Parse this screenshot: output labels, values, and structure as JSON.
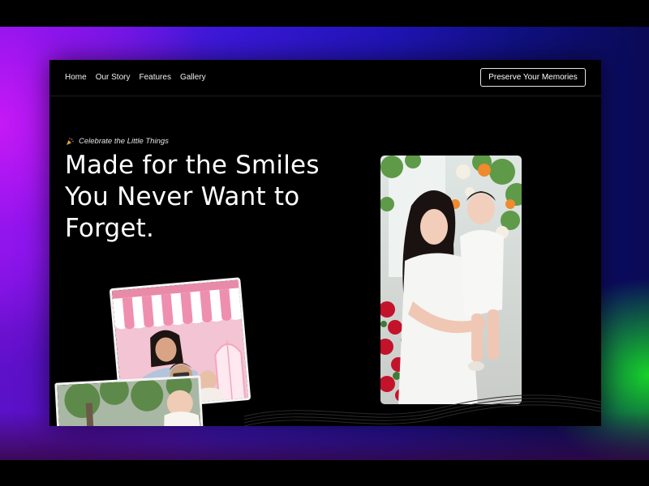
{
  "nav": {
    "links": [
      "Home",
      "Our Story",
      "Features",
      "Gallery"
    ],
    "cta_label": "Preserve Your Memories"
  },
  "hero": {
    "tagline": "Celebrate the Little Things",
    "tagline_icon": "party-popper-icon",
    "headline_lines": [
      "Made for the Smiles",
      "You Never Want to",
      "Forget."
    ]
  },
  "photos": {
    "main": "mother-holding-baby-photo",
    "tilted": "family-pink-storefront-photo",
    "bottom": "baby-outdoors-photo"
  },
  "colors": {
    "accent_purple": "#8a16e8",
    "accent_green": "#17d22a",
    "panel_bg": "#000000",
    "text": "#ffffff"
  }
}
